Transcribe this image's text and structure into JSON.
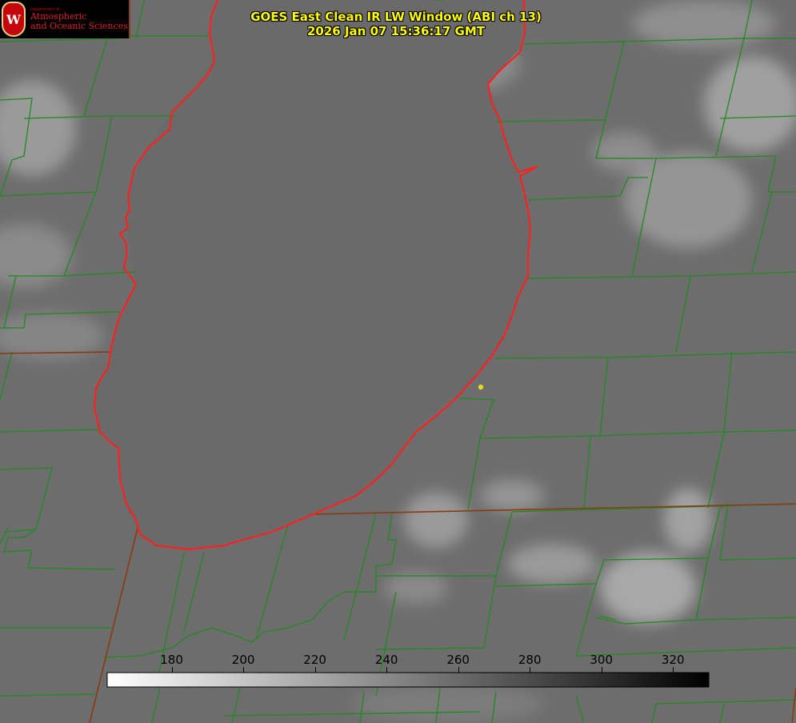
{
  "title": {
    "line1": "GOES East Clean IR LW Window (ABI ch 13)",
    "line2": "2026 Jan 07 15:36:17 GMT"
  },
  "logo": {
    "dept": "Department of",
    "line1": "Atmospheric",
    "line2": "and Oceanic Sciences",
    "seal_letter": "W"
  },
  "colors": {
    "background_gray": "#6f6f6f",
    "county_lines": "#1f8a1f",
    "state_lines": "#8a3a12",
    "coastline": "#ff2020",
    "title_text": "#ffff00",
    "marker": "#e8d81a"
  },
  "colorbar": {
    "ticks": [
      "180",
      "200",
      "220",
      "240",
      "260",
      "280",
      "300",
      "320"
    ],
    "tick_values": [
      180,
      200,
      220,
      240,
      260,
      280,
      300,
      320
    ],
    "range": [
      162,
      330
    ],
    "gradient": "white-to-black"
  }
}
